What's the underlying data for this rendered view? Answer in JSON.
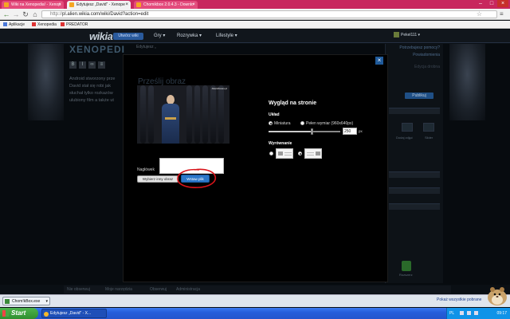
{
  "browser": {
    "tabs": [
      {
        "label": "Wiki na Xenopedia! - Xenop",
        "active": false
      },
      {
        "label": "Edytujesz „David” - Xenope",
        "active": true
      },
      {
        "label": "Chomikbox 2.0.4.3 - Downlo",
        "active": false
      }
    ],
    "url": {
      "scheme": "http://",
      "rest": "pl.alien.wikia.com/wiki/David?action=edit"
    },
    "bookmarks": [
      "Aplikacje",
      "Xenopedia",
      "PREDATOR"
    ]
  },
  "wikia_header": {
    "logo": "wikia",
    "start_wiki": "Utwórz wiki",
    "nav": [
      "Gry ▾",
      "Rozrywka ▾",
      "Lifestyle ▾"
    ],
    "user": "Pekel111 ▾"
  },
  "background_page": {
    "wiki_logo": "XENOPEDI",
    "editing_label": "Edytujesz „",
    "editor_text": "Android stworzony prze\nDavid stał się robi jak\nsłuchał tylko rozkazów\nulubiony film a także ut",
    "help_link": "Potrzebujesz pomocy?",
    "notes_link": "Powiadomienia",
    "rail_small": "Edycja drobna",
    "publish": "Publikuj",
    "rail_caption_1": "Dodaj zdjęć",
    "rail_caption_2": "Slider",
    "rail_caption_3": "Rozszerz"
  },
  "modal": {
    "upload_title": "Prześlij obraz",
    "photo_watermark": "AlienMovies.pl",
    "caption_label": "Nagłówek",
    "caption_value": "",
    "choose_other": "Wybierz inny obraz",
    "insert_file": "Wstaw plik",
    "appearance_title": "Wygląd na stronie",
    "layout_label": "Układ",
    "thumbnail": "Miniatura",
    "full_width": "Pełen wymiar (960x640px)",
    "width_value": "250",
    "width_unit": "px",
    "alignment_label": "Wyrównanie",
    "close_icon": "×",
    "slider_level": 0.6
  },
  "editbar": [
    "Nie obserwuj",
    "Moje narzędzia",
    "Obserwuj",
    "Administracja"
  ],
  "downloads": {
    "file": "Chom!kBox.exe",
    "show_all": "Pokaż wszystkie pobrane"
  },
  "taskbar": {
    "start": "Start",
    "task": "Edytujesz „David” - X...",
    "lang": "PL",
    "clock": "09:17"
  },
  "colors": {
    "accent": "#2b77c9",
    "annotation": "#d8141a"
  }
}
